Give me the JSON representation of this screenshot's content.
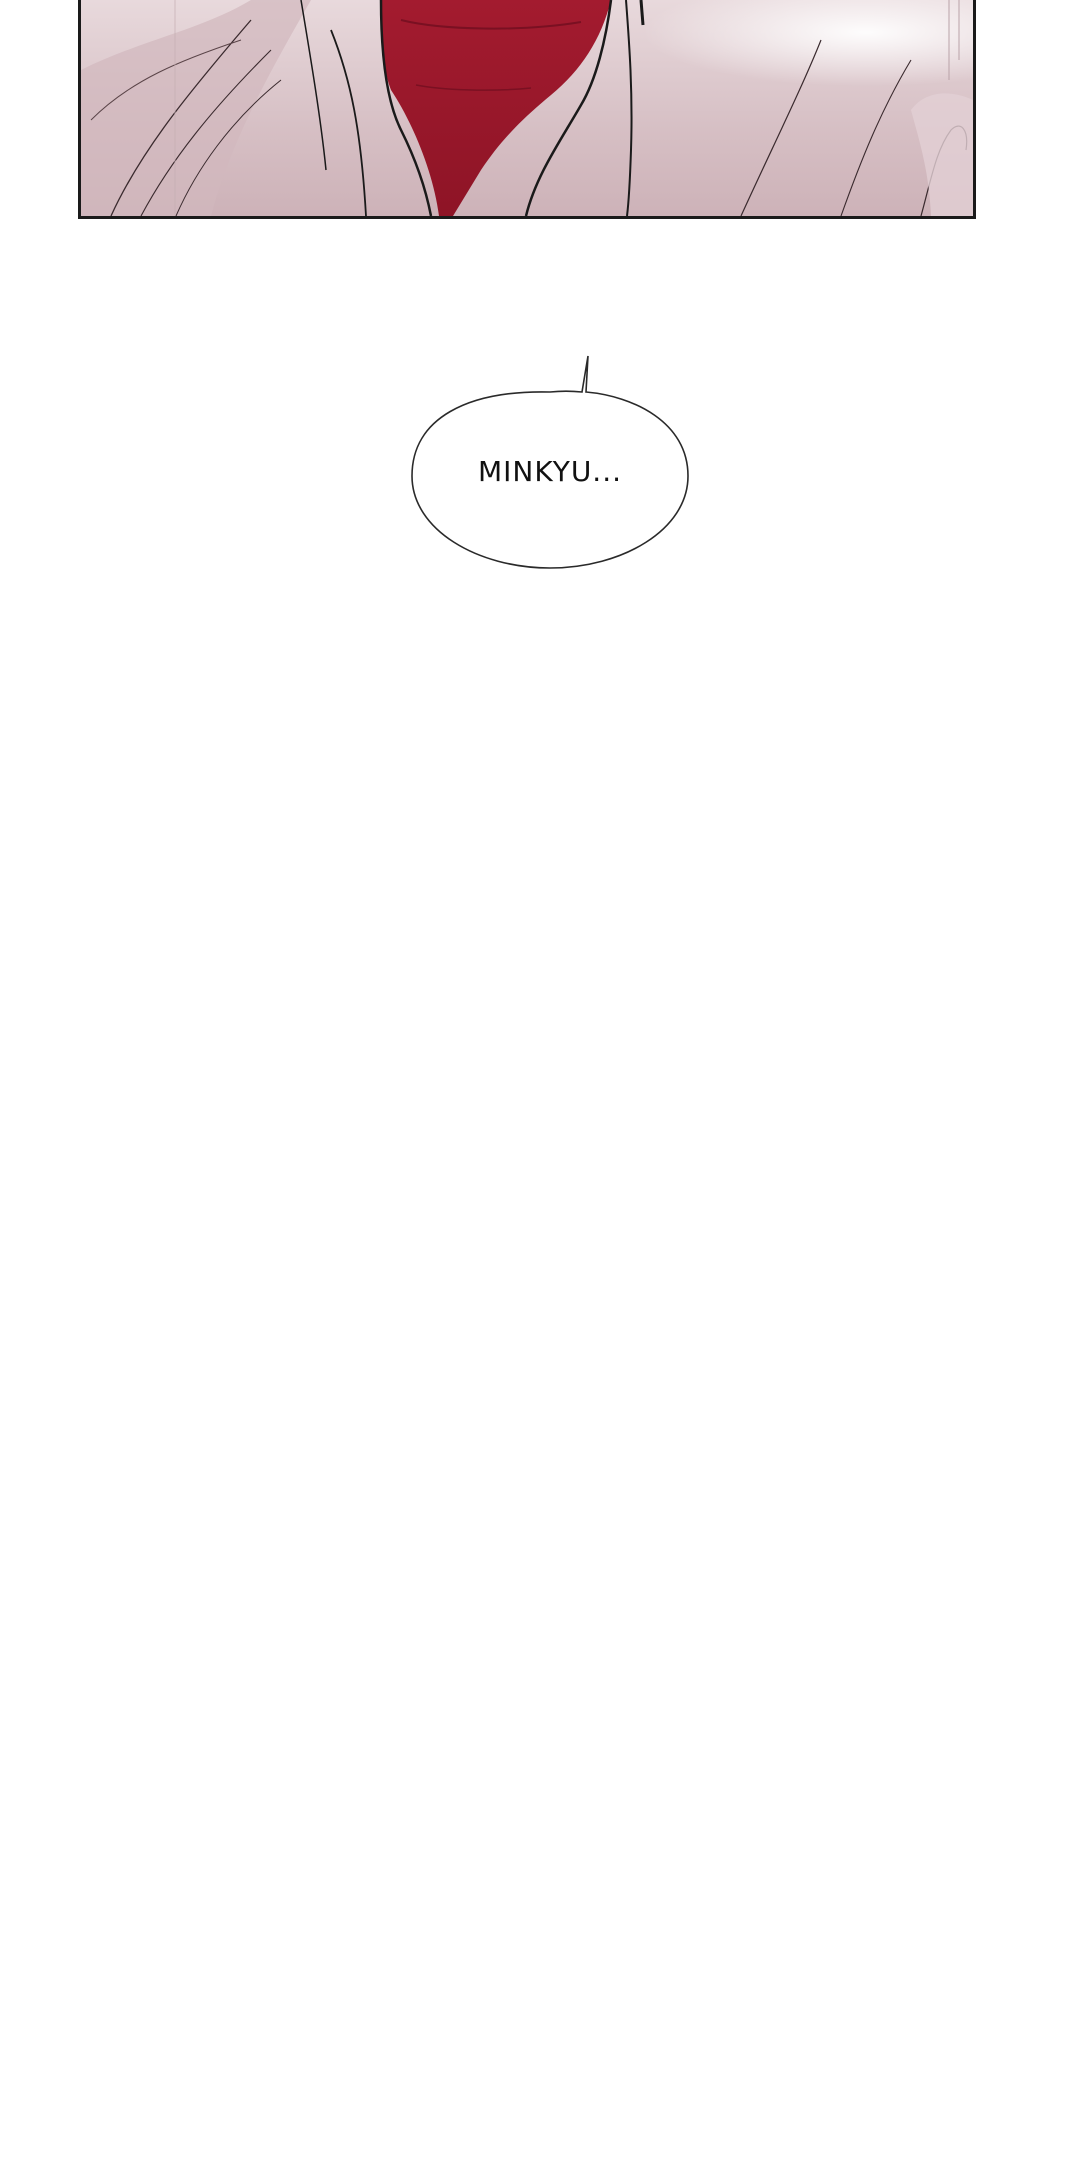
{
  "page": {
    "background_color": "#ffffff"
  },
  "top_panel": {
    "colors": {
      "clothing": "#dcc6ca",
      "clothing_shadow": "#c8abb1",
      "scarf": "#a81e32",
      "scarf_dark": "#8c1428",
      "line": "#1a1a1a",
      "border": "#1a1a1a"
    }
  },
  "speech_bubble": {
    "text": "MINKYU..."
  }
}
